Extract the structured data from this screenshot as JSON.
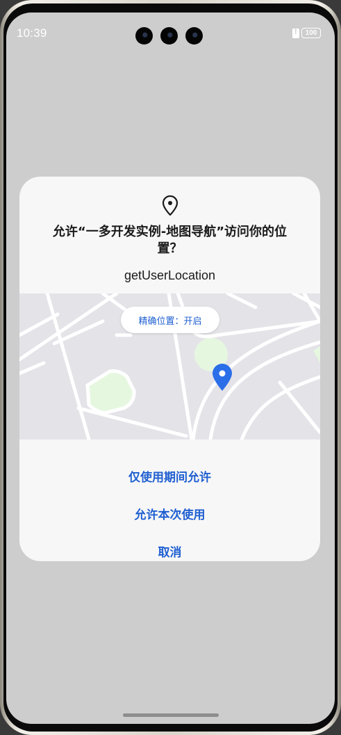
{
  "status_bar": {
    "time": "10:39",
    "battery_level": "100"
  },
  "dialog": {
    "icon": "location-pin-icon",
    "title": "允许“一多开发实例-地图导航”访问你的位置？",
    "subtitle": "getUserLocation",
    "precise_location_label": "精确位置：开启",
    "actions": {
      "while_using": "仅使用期间允许",
      "allow_once": "允许本次使用",
      "cancel": "取消"
    }
  },
  "colors": {
    "accent": "#1f5fd1",
    "marker": "#2a6ee8",
    "map_background": "#e3e3e8",
    "map_park": "#e6f7e0"
  }
}
